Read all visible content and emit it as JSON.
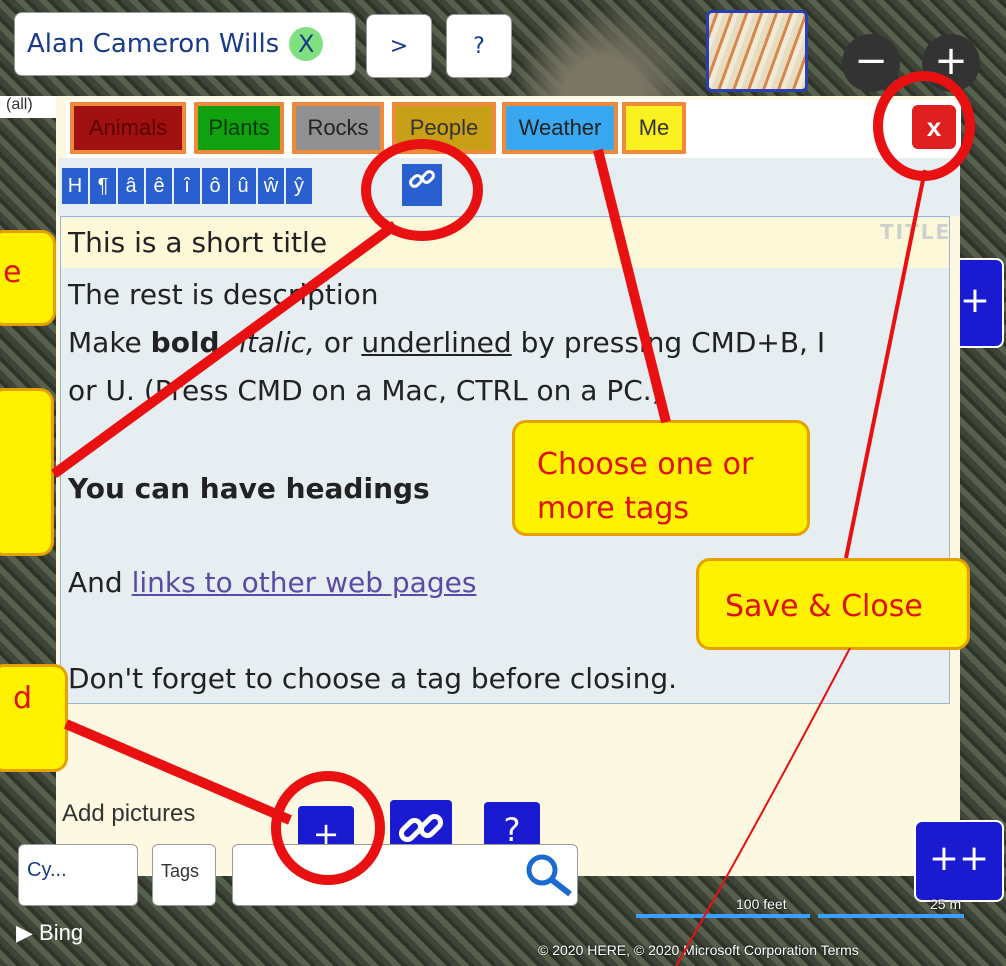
{
  "user": {
    "name": "Alan Cameron Wills",
    "close": "X"
  },
  "top_buttons": {
    "next": ">",
    "help": "?"
  },
  "zoom": {
    "minus": "−",
    "plus": "+"
  },
  "filter": "(all)",
  "tags": [
    {
      "label": "Animals",
      "bg": "#a01010",
      "fg": "#5a0000"
    },
    {
      "label": "Plants",
      "bg": "#10a010",
      "fg": "#003a00"
    },
    {
      "label": "Rocks",
      "bg": "#909090",
      "fg": "#222222"
    },
    {
      "label": "People",
      "bg": "#c8a018",
      "fg": "#333333"
    },
    {
      "label": "Weather",
      "bg": "#3aa8f0",
      "fg": "#222222"
    },
    {
      "label": "Me",
      "bg": "#f8f020",
      "fg": "#333333"
    }
  ],
  "close_button": "x",
  "format_buttons": [
    "H",
    "¶",
    "â",
    "ê",
    "î",
    "ô",
    "û",
    "ŵ",
    "ŷ"
  ],
  "editor": {
    "title_placeholder": "TITLE",
    "line1": "This is a short title",
    "line2": "The rest is description",
    "line3_a": "Make ",
    "line3_bold": "bold,",
    "line3_b": " ",
    "line3_italic": "italic,",
    "line3_c": " or ",
    "line3_underline": "underlined",
    "line3_d": " by pressing CMD+B, I",
    "line4": "or U. (Press CMD on a Mac, CTRL on a PC.)",
    "heading": "You can have headings",
    "line6_a": "And ",
    "line6_link": "links to other web pages",
    "line7": "Don't forget to choose a tag before closing."
  },
  "add_pictures": "Add pictures",
  "bottom_buttons": {
    "add": "+",
    "help": "?",
    "more": "++",
    "side": "+"
  },
  "bottom_bar": {
    "left": "Cy...",
    "tags": "Tags"
  },
  "bing": "Bing",
  "copyright": "© 2020 HERE, © 2020 Microsoft Corporation  Terms",
  "scale": {
    "feet": "100 feet",
    "meters": "25 m"
  },
  "callouts": {
    "tags": "Choose one or\nmore tags",
    "save": "Save & Close",
    "left1": "e",
    "left3": "d"
  },
  "colors": {
    "callout_bg": "#fff200",
    "callout_text": "#e01010",
    "marker": "#e81010"
  }
}
